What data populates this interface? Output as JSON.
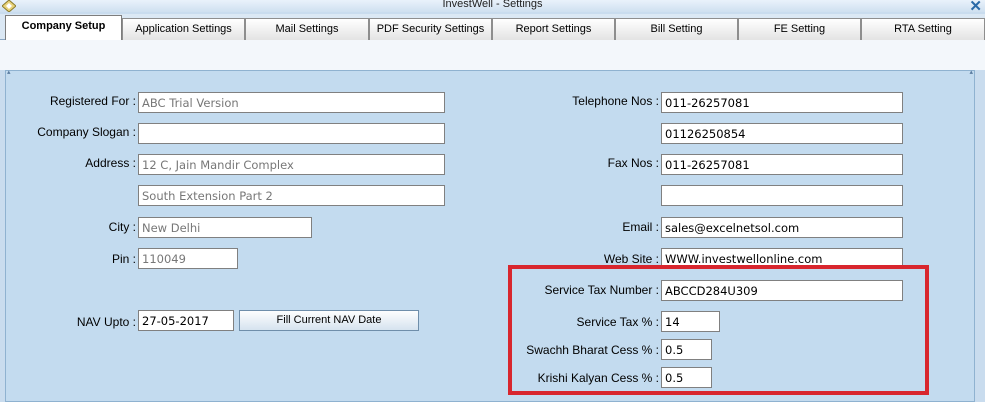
{
  "window": {
    "title": "InvestWell - Settings"
  },
  "tabs": [
    {
      "label": "Company Setup"
    },
    {
      "label": "Application Settings"
    },
    {
      "label": "Mail Settings"
    },
    {
      "label": "PDF Security Settings"
    },
    {
      "label": "Report Settings"
    },
    {
      "label": "Bill Setting"
    },
    {
      "label": "FE Setting"
    },
    {
      "label": "RTA Setting"
    }
  ],
  "form": {
    "registered_for": {
      "label": "Registered For :",
      "value": "ABC Trial Version"
    },
    "company_slogan": {
      "label": "Company Slogan :",
      "value": ""
    },
    "address": {
      "label": "Address :",
      "line1": "12 C, Jain Mandir Complex",
      "line2": "South Extension Part 2"
    },
    "city": {
      "label": "City :",
      "value": "New Delhi"
    },
    "pin": {
      "label": "Pin :",
      "value": "110049"
    },
    "nav_upto": {
      "label": "NAV Upto :",
      "value": "27-05-2017",
      "button_label": "Fill Current NAV Date"
    },
    "telephone": {
      "label": "Telephone Nos :",
      "value1": "011-26257081",
      "value2": "01126250854"
    },
    "fax": {
      "label": "Fax Nos :",
      "value1": "011-26257081",
      "value2": ""
    },
    "email": {
      "label": "Email :",
      "value": "sales@excelnetsol.com"
    },
    "website": {
      "label": "Web Site :",
      "value": "WWW.investwellonline.com"
    },
    "service_tax_number": {
      "label": "Service Tax Number :",
      "value": "ABCCD284U309"
    },
    "service_tax_pct": {
      "label": "Service Tax % :",
      "value": "14"
    },
    "swachh_bharat_cess": {
      "label": "Swachh Bharat Cess % :",
      "value": "0.5"
    },
    "krishi_kalyan_cess": {
      "label": "Krishi Kalyan Cess  % :",
      "value": "0.5"
    }
  },
  "colors": {
    "highlight_border": "#d8262e",
    "panel_bg": "#c3dbef"
  }
}
